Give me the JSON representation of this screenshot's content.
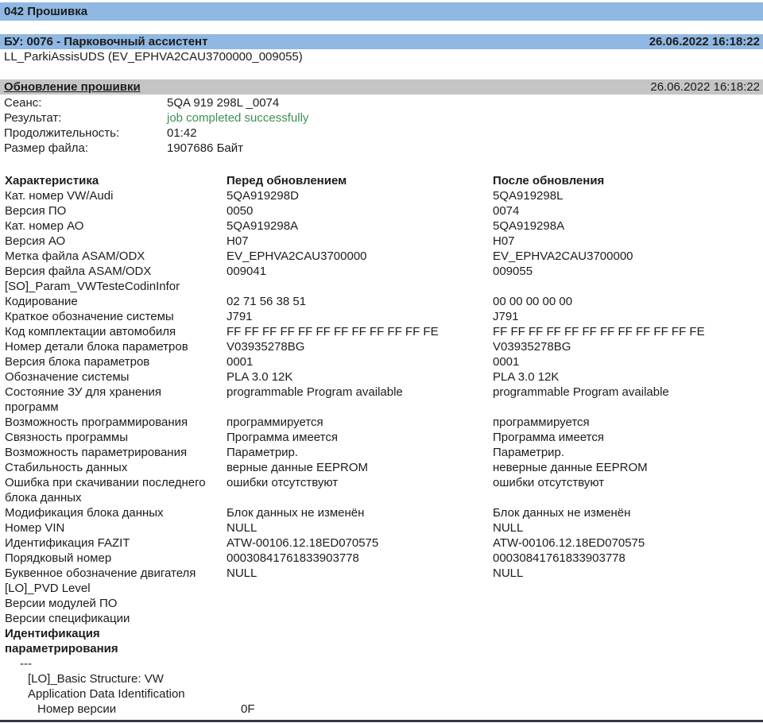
{
  "colors": {
    "bar_blue": "#8fb8e2",
    "bar_gray": "#c5c5c5",
    "green": "#3f8e55",
    "bottom_line": "#333a46"
  },
  "title_bar": {
    "label": "042 Прошивка"
  },
  "ecu_bar": {
    "label": "БУ: 0076 - Парковочный ассистент",
    "timestamp": "26.06.2022 16:18:22"
  },
  "ecu_subtitle": "LL_ParkiAssisUDS (EV_EPHVA2CAU3700000_009055)",
  "section_bar": {
    "label": "Обновление прошивки",
    "timestamp": "26.06.2022 16:18:22"
  },
  "summary": {
    "rows": [
      {
        "label": "Сеанс:",
        "value": "5QA 919 298L _0074"
      },
      {
        "label": "Результат:",
        "value": "job completed successfully",
        "status": "success"
      },
      {
        "label": "Продолжительность:",
        "value": "01:42"
      },
      {
        "label": "Размер файла:",
        "value": "1907686 Байт"
      }
    ]
  },
  "table": {
    "headers": [
      "Характеристика",
      "Перед обновлением",
      "После обновления"
    ],
    "rows": [
      {
        "label": "Кат. номер VW/Audi",
        "before": "5QA919298D",
        "after": "5QA919298L"
      },
      {
        "label": "Версия ПО",
        "before": "0050",
        "after": "0074"
      },
      {
        "label": "Кат. номер АО",
        "before": "5QA919298A",
        "after": "5QA919298A"
      },
      {
        "label": "Версия АО",
        "before": "H07",
        "after": "H07"
      },
      {
        "label": "Метка файла ASAM/ODX",
        "before": "EV_EPHVA2CAU3700000",
        "after": "EV_EPHVA2CAU3700000"
      },
      {
        "label": "Версия файла ASAM/ODX",
        "before": "009041",
        "after": "009055"
      },
      {
        "label": "[SO]_Param_VWTesteCodinInfor",
        "before": "",
        "after": ""
      },
      {
        "label": "Кодирование",
        "before": "02 71 56 38 51",
        "after": "00 00 00 00 00"
      },
      {
        "label": "Краткое обозначение системы",
        "before": "J791",
        "after": "J791"
      },
      {
        "label": "Код комплектации автомобиля",
        "before": "FF FF FF FF FF FF FF FF FF FF FF FE",
        "after": "FF FF FF FF FF FF FF FF FF FF FF FE"
      },
      {
        "label": "Номер детали блока параметров",
        "before": "V03935278BG",
        "after": "V03935278BG"
      },
      {
        "label": "Версия блока параметров",
        "before": "0001",
        "after": "0001"
      },
      {
        "label": "Обозначение системы",
        "before": "PLA 3.0 12K",
        "after": "PLA 3.0 12K"
      },
      {
        "label": "Состояние ЗУ для хранения программ",
        "before": "programmable Program available",
        "after": "programmable Program available",
        "wrap": true
      },
      {
        "label": "Возможность программирования",
        "before": "программируется",
        "after": "программируется"
      },
      {
        "label": "Связность программы",
        "before": "Программа имеется",
        "after": "Программа имеется"
      },
      {
        "label": "Возможность параметрирования",
        "before": "Параметрир.",
        "after": "Параметрир."
      },
      {
        "label": "Стабильность данных",
        "before": "верные данные EEPROM",
        "after": "неверные данные EEPROM"
      },
      {
        "label": "Ошибка при скачивании последнего блока данных",
        "before": "ошибки отсутствуют",
        "after": "ошибки отсутствуют"
      },
      {
        "label": "Модификация блока данных",
        "before": "Блок данных не изменён",
        "after": "Блок данных не изменён"
      },
      {
        "label": "Номер VIN",
        "before": "NULL",
        "after": "NULL"
      },
      {
        "label": "Идентификация FAZIT",
        "before": "ATW-00106.12.18ED070575",
        "after": "ATW-00106.12.18ED070575"
      },
      {
        "label": "Порядковый номер",
        "before": "00030841761833903778",
        "after": "00030841761833903778"
      },
      {
        "label": "Буквенное обозначение двигателя",
        "before": "NULL",
        "after": "NULL"
      },
      {
        "label": "[LO]_PVD Level",
        "before": "",
        "after": ""
      },
      {
        "label": "Версии модулей ПО",
        "before": "",
        "after": ""
      },
      {
        "label": "Версии спецификации",
        "before": "",
        "after": ""
      },
      {
        "label": "Идентификация параметрирования",
        "before": "",
        "after": "",
        "bold": true,
        "wrap": true
      },
      {
        "label": "---",
        "before": "",
        "after": "",
        "indent": 1
      },
      {
        "label": "[LO]_Basic Structure: VW",
        "before": "",
        "after": "",
        "indent": 2
      },
      {
        "label": "Application Data Identification",
        "before": "",
        "after": "",
        "indent": 2
      },
      {
        "label": "Номер версии",
        "before": "0F",
        "after": "",
        "indent": 3,
        "value_indent": true
      }
    ]
  }
}
